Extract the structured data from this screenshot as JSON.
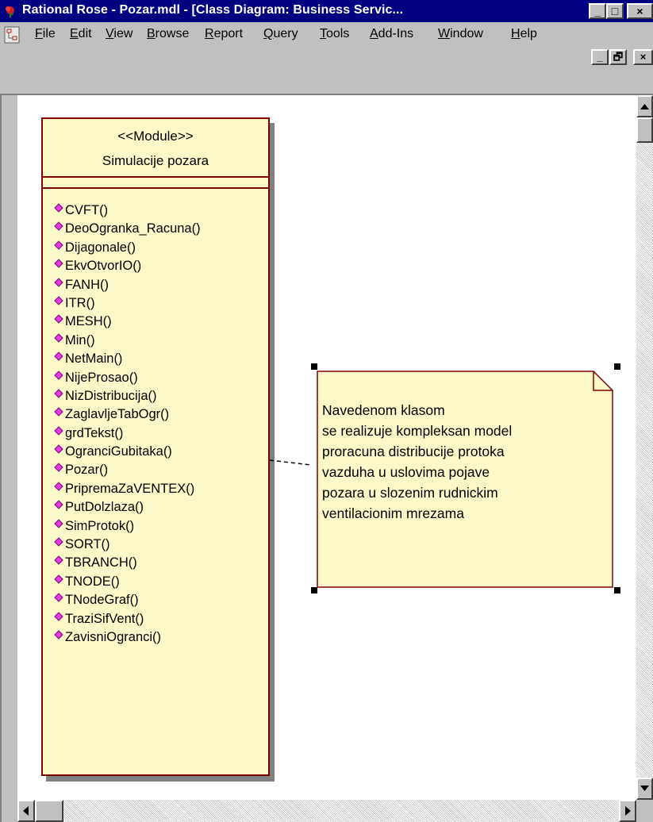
{
  "window": {
    "title": "Rational Rose - Pozar.mdl - [Class Diagram: Business Servic...",
    "buttons": [
      "_",
      "□",
      "×"
    ]
  },
  "menu": {
    "items": [
      {
        "label": "File"
      },
      {
        "label": "Edit"
      },
      {
        "label": "View"
      },
      {
        "label": "Browse"
      },
      {
        "label": "Report"
      },
      {
        "label": "Query"
      },
      {
        "label": "Tools"
      },
      {
        "label": "Add-Ins"
      },
      {
        "label": "Window"
      },
      {
        "label": "Help"
      }
    ],
    "mdi_buttons": [
      "_",
      "🗗",
      "×"
    ]
  },
  "class": {
    "stereotype": "<<Module>>",
    "name": "Simulacije pozara",
    "operations": [
      "CVFT()",
      "DeoOgranka_Racuna()",
      "Dijagonale()",
      "EkvOtvorIO()",
      "FANH()",
      "ITR()",
      "MESH()",
      "Min()",
      "NetMain()",
      "NijeProsao()",
      "NizDistribucija()",
      "ZaglavljeTabOgr()",
      "grdTekst()",
      "OgranciGubitaka()",
      "Pozar()",
      "PripremaZaVENTEX()",
      "PutDolzlaza()",
      "SimProtok()",
      "SORT()",
      "TBRANCH()",
      "TNODE()",
      "TNodeGraf()",
      "TraziSifVent()",
      "ZavisniOgranci()"
    ],
    "fill_color": "#fcf8c8",
    "border_color": "#800000",
    "operation_icon_color": "#e040e0"
  },
  "note": {
    "lines": [
      "Navedenom klasom",
      "se realizuje kompleksan model",
      "proracuna distribucije protoka",
      "vazduha u uslovima pojave",
      "pozara u slozenim rudnickim",
      "ventilacionim mrezama"
    ],
    "fill_color": "#fcf8c8"
  },
  "colors": {
    "titlebar": "#000080",
    "chrome": "#c0c0c0"
  }
}
